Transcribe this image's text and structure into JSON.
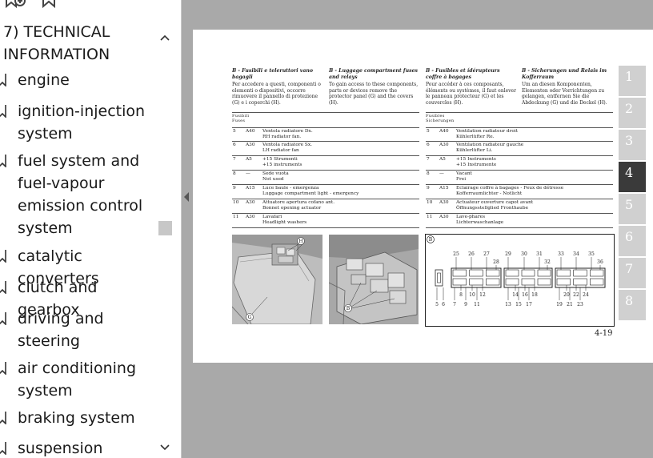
{
  "sidebar": {
    "title": "7) TECHNICAL INFORMATION",
    "items": [
      {
        "label": "engine"
      },
      {
        "label": "ignition-injection system"
      },
      {
        "label": "fuel system and fuel-vapour emission control system"
      },
      {
        "label": "catalytic converters"
      },
      {
        "label": "clutch and gearbox"
      },
      {
        "label": "driving and steering"
      },
      {
        "label": "air conditioning system"
      },
      {
        "label": "braking system"
      },
      {
        "label": "suspension"
      }
    ]
  },
  "page": {
    "columns": [
      {
        "heading": "B - Fusibili e teleruttori vano bagagli",
        "body": "Per accedere a questi, componenti o elementi o dispositivi, occorre rimuovere il pannello di protezione (G) e i coperchi (H)."
      },
      {
        "heading": "B - Luggage compartment fuses and relays",
        "body": "To gain access to these components, parts or devices remove the protector panel (G) and the covers (H)."
      },
      {
        "heading": "B - Fusibles et ídérupteurs coffre à bagages",
        "body": "Pour accéder à ces composants, éléments ou systèmes, il faut enlever le panneau protecteur (G) et les couvercles (H)."
      },
      {
        "heading": "B - Sicherungen und Relais im Kofferraum",
        "body": "Um an diesen Komponenten, Elementen oder Vorrichtungen zu gelangen, entfernen Sie die Abdeckung (G) und die Deckel (H)."
      }
    ],
    "fuses_left": {
      "header1": "Fusibili",
      "header2": "Fuses",
      "rows": [
        {
          "n": "5",
          "a": "A40",
          "l1": "Ventola radiatore Dx.",
          "l2": "RH radiator fan."
        },
        {
          "n": "6",
          "a": "A30",
          "l1": "Ventola radiatore Sx.",
          "l2": "LH radiator fan"
        },
        {
          "n": "7",
          "a": "A5",
          "l1": "+15 Strumenti",
          "l2": "+15 instruments"
        },
        {
          "n": "8",
          "a": "—",
          "l1": "Sede vuota",
          "l2": "Not used"
        },
        {
          "n": "9",
          "a": "A15",
          "l1": "Luce baule - emergenza",
          "l2": "Luggage compartment light - emergency"
        },
        {
          "n": "10",
          "a": "A30",
          "l1": "Attuatore apertura cofano ant.",
          "l2": "Bonnet opening actuator"
        },
        {
          "n": "11",
          "a": "A30",
          "l1": "Lavafari",
          "l2": "Headlight washers"
        }
      ]
    },
    "fuses_right": {
      "header1": "Fusibles",
      "header2": "Sicherungen",
      "rows": [
        {
          "n": "5",
          "a": "A40",
          "l1": "Ventilation radiateur droit",
          "l2": "Kühlerlüfter Re."
        },
        {
          "n": "6",
          "a": "A30",
          "l1": "Ventilation radiateur gauche",
          "l2": "Kühlerlüfter Li."
        },
        {
          "n": "7",
          "a": "A5",
          "l1": "+15 Instruments",
          "l2": "+15 Instrumente"
        },
        {
          "n": "8",
          "a": "—",
          "l1": "Vacant",
          "l2": "Frei"
        },
        {
          "n": "9",
          "a": "A15",
          "l1": "Eclairage coffre à bagages - Feux de détresse",
          "l2": "Kofferraumlichter - Notlicht"
        },
        {
          "n": "10",
          "a": "A30",
          "l1": "Actuateur ouverture capot avant",
          "l2": "Öffnungsstellglied Fronthaube"
        },
        {
          "n": "11",
          "a": "A30",
          "l1": "Lave-phares",
          "l2": "Lichterwaschanlage"
        }
      ]
    },
    "photo_labels": {
      "g": "G",
      "h": "H",
      "b": "B"
    },
    "diagram": {
      "corner": "B",
      "top_numbers": [
        "25",
        "26",
        "27",
        "28",
        "29",
        "30",
        "31",
        "32",
        "33",
        "34",
        "35",
        "36"
      ],
      "mid_numbers": [
        "8",
        "10",
        "12",
        "14",
        "16",
        "18",
        "20",
        "22",
        "24"
      ],
      "bottom_numbers": [
        "5",
        "6",
        "7",
        "9",
        "11",
        "13",
        "15",
        "17",
        "19",
        "21",
        "23"
      ]
    },
    "page_number": "4-19",
    "tabs": [
      "1",
      "2",
      "3",
      "4",
      "5",
      "6",
      "7",
      "8"
    ],
    "active_tab": "4"
  },
  "colors": {
    "viewer_bg": "#a9a9a9",
    "tab_bg": "#d0d0d0",
    "tab_active": "#3a3a3a"
  },
  "icons": [
    "add-bookmark-icon",
    "bookmark-icon",
    "bookmark-item-icon",
    "chevron-up-icon",
    "chevron-down-icon",
    "collapse-panel-icon"
  ]
}
